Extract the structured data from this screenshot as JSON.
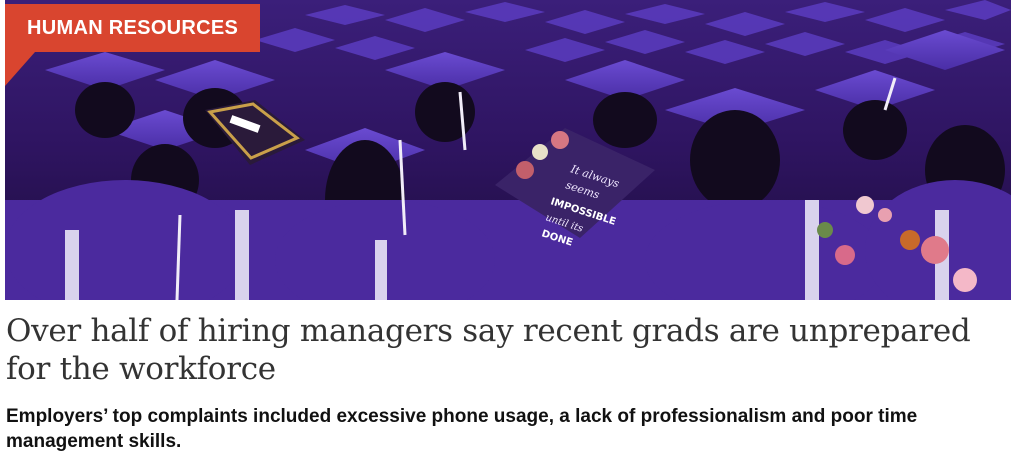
{
  "category": {
    "label": "HUMAN RESOURCES",
    "color": "#d9452f"
  },
  "hero": {
    "subject": "graduation-crowd-photo",
    "cap_text": "It always seems impossible until it's DONE",
    "gown_color": "#4b2a9e"
  },
  "article": {
    "headline": "Over half of hiring managers say recent grads are unprepared for the workforce",
    "dek": "Employers’ top complaints included excessive phone usage, a lack of professionalism and poor time management skills."
  }
}
